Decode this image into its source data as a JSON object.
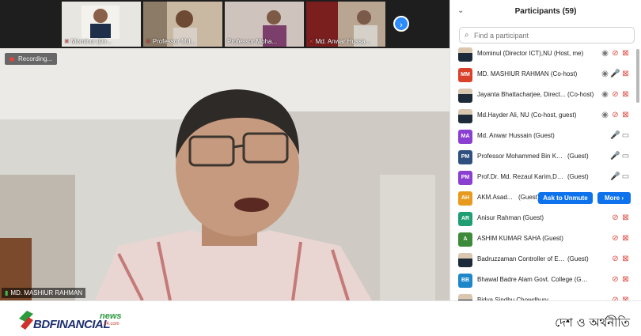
{
  "thumbnails": [
    {
      "name": "Mominul (Dir...",
      "muted": true
    },
    {
      "name": "Professor Md...",
      "muted": true
    },
    {
      "name": "Professor Moha...",
      "muted": false
    },
    {
      "name": "Md. Anwar Hussa...",
      "muted": true
    }
  ],
  "recording_label": "Recording...",
  "active_speaker": "MD. MASHIUR RAHMAN",
  "panel": {
    "title": "Participants (59)",
    "search_placeholder": "Find a participant",
    "ask_to_unmute": "Ask to Unmute",
    "more": "More ›"
  },
  "participants": [
    {
      "avatar": "photo",
      "initials": "",
      "color": "#3a4a6b",
      "name": "Mominul (Director ICT),NU (Host, me)",
      "role": "",
      "icons": [
        "eye",
        "mic-off",
        "cam-off"
      ]
    },
    {
      "avatar": "initials",
      "initials": "MM",
      "color": "#d9412b",
      "name": "MD. MASHIUR RAHMAN (Co-host)",
      "role": "",
      "icons": [
        "eye",
        "mic",
        "cam-off"
      ]
    },
    {
      "avatar": "photo",
      "initials": "",
      "color": "#555",
      "name": "Jayanta Bhattacharjee, Direct...",
      "role": "(Co-host)",
      "icons": [
        "eye",
        "mic-off",
        "cam-off"
      ]
    },
    {
      "avatar": "photo",
      "initials": "",
      "color": "#555",
      "name": "Md.Hayder Ali, NU (Co-host, guest)",
      "role": "",
      "icons": [
        "eye",
        "mic-off",
        "cam-off"
      ]
    },
    {
      "avatar": "initials",
      "initials": "MA",
      "color": "#8a3fd1",
      "name": "Md. Anwar Hussain (Guest)",
      "role": "",
      "icons": [
        "mic",
        "cam"
      ]
    },
    {
      "avatar": "initials",
      "initials": "PM",
      "color": "#2f4f7f",
      "name": "Professor Mohammed Bin Kashem, ...",
      "role": "(Guest)",
      "icons": [
        "mic",
        "cam"
      ]
    },
    {
      "avatar": "initials",
      "initials": "PM",
      "color": "#8a3fd1",
      "name": "Prof.Dr. Md. Rezaul Karim,Debendr...",
      "role": "(Guest)",
      "icons": [
        "mic",
        "cam"
      ]
    },
    {
      "avatar": "initials",
      "initials": "AH",
      "color": "#e79a1d",
      "name": "AKM.Asad...",
      "role": "(Guest)",
      "icons": [],
      "actions": true
    },
    {
      "avatar": "initials",
      "initials": "AR",
      "color": "#1f9e74",
      "name": "Anisur Rahman (Guest)",
      "role": "",
      "icons": [
        "mic-off",
        "cam-off"
      ]
    },
    {
      "avatar": "initials",
      "initials": "A",
      "color": "#3d8a3a",
      "name": "ASHIM KUMAR SAHA (Guest)",
      "role": "",
      "icons": [
        "mic-off",
        "cam-off"
      ]
    },
    {
      "avatar": "photo",
      "initials": "",
      "color": "#555",
      "name": "Badruzzaman Controller of Exam,N U",
      "role": "(Guest)",
      "icons": [
        "mic-off",
        "cam-off"
      ]
    },
    {
      "avatar": "initials",
      "initials": "BB",
      "color": "#1d87c9",
      "name": "Bhawal Badre Alam Govt. College (Guest)",
      "role": "",
      "icons": [
        "mic-off",
        "cam-off"
      ]
    },
    {
      "avatar": "photo",
      "initials": "",
      "color": "#555",
      "name": "Bidya Sindhu Chowdhury, ...",
      "role": "",
      "icons": [
        "mic-off",
        "cam-off"
      ]
    }
  ],
  "icon_glyphs": {
    "eye": "◉",
    "mic": "🎤",
    "mic-off": "⊘",
    "cam": "▭",
    "cam-off": "⊠"
  },
  "footer": {
    "brand": "BDFINANCIAL",
    "brand_news": "news",
    "brand_domain": "24.com",
    "tagline": "দেশ ও অর্থনীতি"
  }
}
